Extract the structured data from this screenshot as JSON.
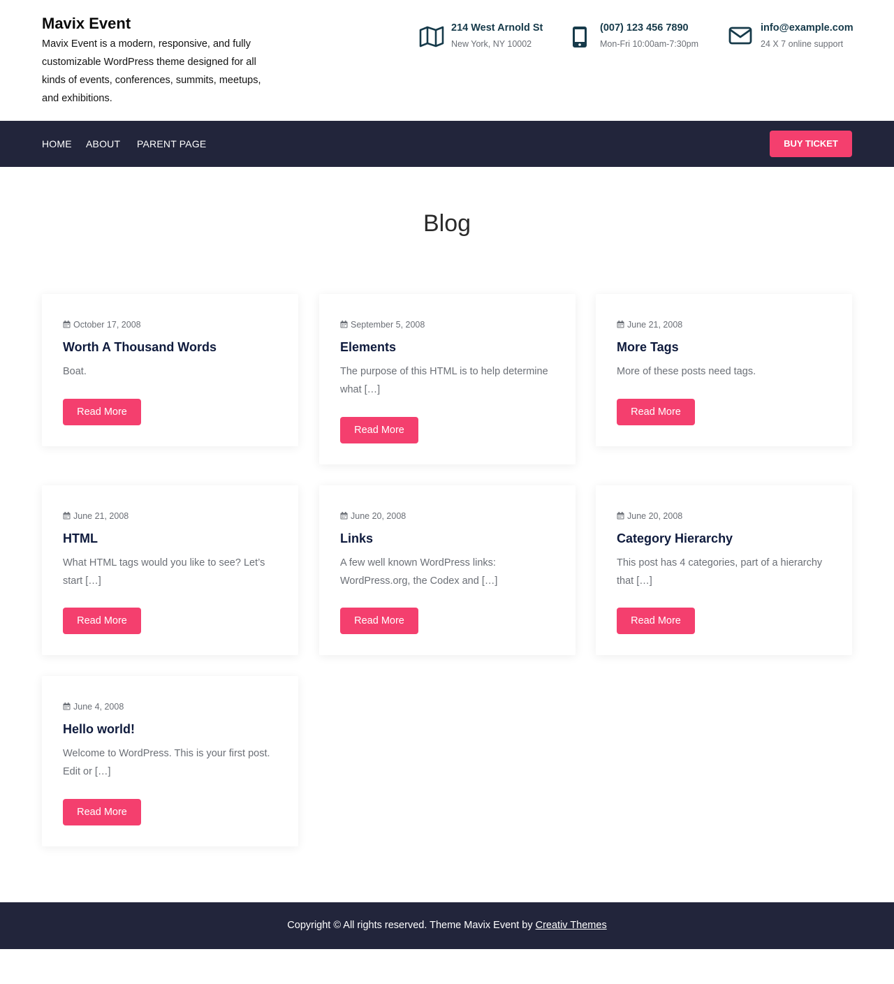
{
  "brand": {
    "title": "Mavix Event",
    "description": "Mavix Event is a modern, responsive, and fully customizable WordPress theme designed for all kinds of events, conferences, summits, meetups, and exhibitions."
  },
  "contacts": [
    {
      "icon": "map-icon",
      "title": "214 West Arnold St",
      "sub": "New York, NY 10002"
    },
    {
      "icon": "phone-icon",
      "title": "(007) 123 456 7890",
      "sub": "Mon-Fri 10:00am-7:30pm"
    },
    {
      "icon": "envelope-icon",
      "title": "info@example.com",
      "sub": "24 X 7 online support"
    }
  ],
  "nav": {
    "items": [
      {
        "label": "HOME"
      },
      {
        "label": "ABOUT"
      },
      {
        "label": "PARENT PAGE"
      }
    ],
    "cta": "BUY TICKET"
  },
  "page": {
    "title": "Blog"
  },
  "posts": [
    {
      "date": "October 17, 2008",
      "title": "Worth A Thousand Words",
      "excerpt": "Boat.",
      "button": "Read More"
    },
    {
      "date": "September 5, 2008",
      "title": "Elements",
      "excerpt": "The purpose of this HTML is to help determine what […]",
      "button": "Read More"
    },
    {
      "date": "June 21, 2008",
      "title": "More Tags",
      "excerpt": "More of these posts need tags.",
      "button": "Read More"
    },
    {
      "date": "June 21, 2008",
      "title": "HTML",
      "excerpt": "What HTML tags would you like to see? Let’s start […]",
      "button": "Read More"
    },
    {
      "date": "June 20, 2008",
      "title": "Links",
      "excerpt": "A few well known WordPress links: WordPress.org, the Codex and […]",
      "button": "Read More"
    },
    {
      "date": "June 20, 2008",
      "title": "Category Hierarchy",
      "excerpt": "This post has 4 categories, part of a hierarchy that […]",
      "button": "Read More"
    },
    {
      "date": "June 4, 2008",
      "title": "Hello world!",
      "excerpt": "Welcome to WordPress. This is your first post. Edit or […]",
      "button": "Read More"
    }
  ],
  "footer": {
    "text": "Copyright © All rights reserved. Theme Mavix Event by ",
    "link": "Creativ Themes"
  },
  "colors": {
    "accent": "#f43f6e",
    "navbar": "#22253b",
    "heading": "#0f1b3d",
    "contact_icon": "#163a4a"
  }
}
